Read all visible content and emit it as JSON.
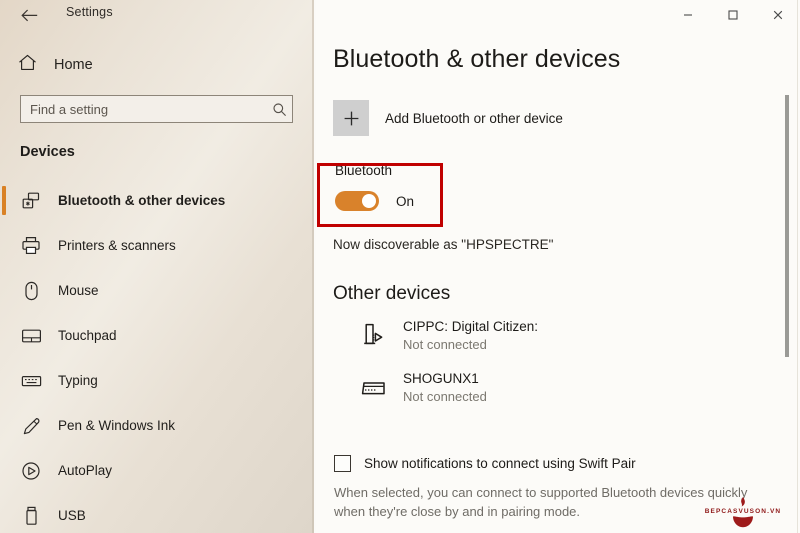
{
  "window": {
    "back_label": "←",
    "app_title": "Settings",
    "minimize_label": "—",
    "maximize_label": "▫",
    "close_label": "✕"
  },
  "sidebar": {
    "home_label": "Home",
    "search": {
      "placeholder": "Find a setting",
      "value": "",
      "icon": "search-icon"
    },
    "section_label": "Devices",
    "items": [
      {
        "label": "Bluetooth & other devices",
        "icon": "bluetooth-devices-icon",
        "selected": true
      },
      {
        "label": "Printers & scanners",
        "icon": "printer-icon",
        "selected": false
      },
      {
        "label": "Mouse",
        "icon": "mouse-icon",
        "selected": false
      },
      {
        "label": "Touchpad",
        "icon": "touchpad-icon",
        "selected": false
      },
      {
        "label": "Typing",
        "icon": "keyboard-icon",
        "selected": false
      },
      {
        "label": "Pen & Windows Ink",
        "icon": "pen-icon",
        "selected": false
      },
      {
        "label": "AutoPlay",
        "icon": "autoplay-icon",
        "selected": false
      },
      {
        "label": "USB",
        "icon": "usb-icon",
        "selected": false
      }
    ]
  },
  "main": {
    "page_title": "Bluetooth & other devices",
    "add_device": {
      "label": "Add Bluetooth or other device",
      "icon": "plus-icon"
    },
    "bluetooth": {
      "label": "Bluetooth",
      "toggle_state": "On",
      "toggle_on": true,
      "discoverable_text": "Now discoverable as \"HPSPECTRE\""
    },
    "other_devices": {
      "heading": "Other devices",
      "devices": [
        {
          "name": "CIPPC: Digital Citizen:",
          "status": "Not connected",
          "icon": "cast-display-icon"
        },
        {
          "name": "SHOGUNX1",
          "status": "Not connected",
          "icon": "keyboard-device-icon"
        }
      ]
    },
    "swift_pair": {
      "checkbox_label": "Show notifications to connect using Swift Pair",
      "checked": false,
      "description": "When selected, you can connect to supported Bluetooth devices quickly when they're close by and in pairing mode."
    }
  },
  "annotation": {
    "highlight_color": "#c00000",
    "target": "bluetooth-toggle"
  },
  "colors": {
    "accent": "#d98125",
    "toggle_on": "#d9822b",
    "sidebar_bg": "#eae2d6",
    "main_bg": "#fcfbf8"
  },
  "watermark": {
    "text": "BEPCASVUSON.VN",
    "color": "#8e1717"
  }
}
